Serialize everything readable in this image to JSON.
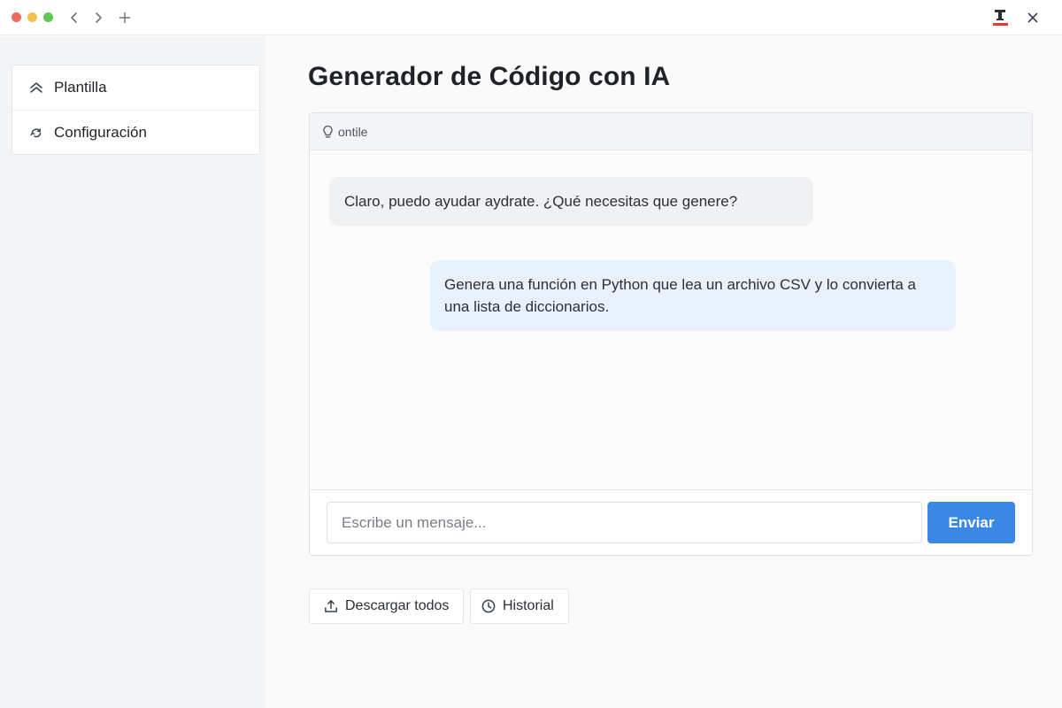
{
  "window": {
    "traffic_lights": [
      "#ee6a5f",
      "#f5be4f",
      "#62c554"
    ],
    "icons": [
      "chevron-left-icon",
      "chevron-right-icon",
      "plus-icon",
      "app-logo-icon",
      "close-icon"
    ]
  },
  "sidebar": {
    "items": [
      {
        "label": "Plantilla",
        "icon": "double-chevron-up-icon"
      },
      {
        "label": "Configuración",
        "icon": "sync-icon"
      }
    ]
  },
  "main": {
    "title": "Generador de Código con IA",
    "chat": {
      "header_label": "ontile",
      "header_icon": "lightbulb-icon",
      "messages": [
        {
          "role": "assistant",
          "text": "Claro, puedo ayudar aydrate. ¿Qué necesitas que genere?"
        },
        {
          "role": "user",
          "text": "Genera una función en Python que lea un archivo CSV y lo convierta a una lista de diccionarios."
        }
      ],
      "input_placeholder": "Escribe un mensaje...",
      "input_value": "",
      "send_label": "Enviar"
    },
    "actions": {
      "download_label": "Descargar todos",
      "download_icon": "upload-icon",
      "history_label": "Historial",
      "history_icon": "clock-icon"
    }
  },
  "colors": {
    "accent": "#3b87e4",
    "user_bubble": "#e8f1fc",
    "assistant_bubble": "#f0f1f3",
    "logo_red": "#e03a3a"
  }
}
